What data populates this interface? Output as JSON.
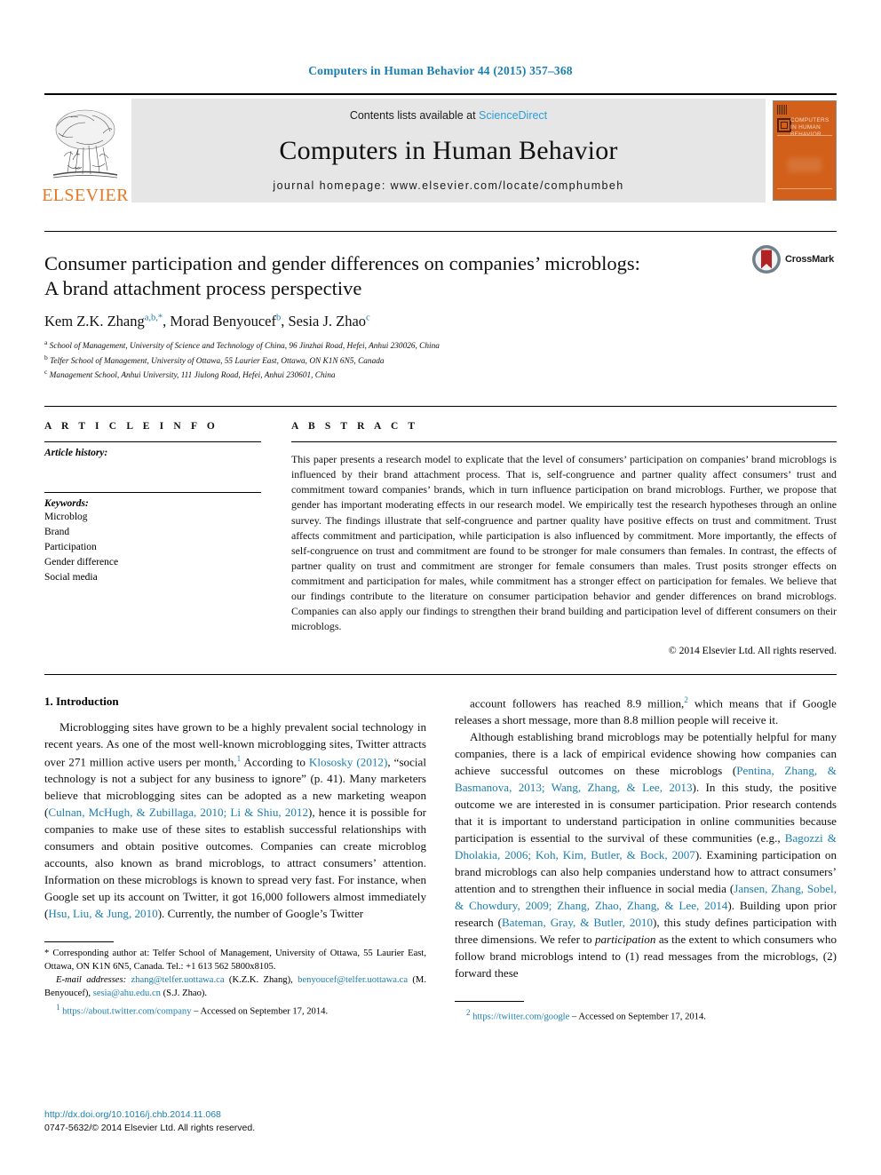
{
  "running_head": "Computers in Human Behavior 44 (2015) 357–368",
  "masthead": {
    "publisher_logo_text": "ELSEVIER",
    "contents_prefix": "Contents lists available at ",
    "contents_link": "ScienceDirect",
    "journal_title": "Computers in Human Behavior",
    "journal_homepage": "journal homepage: www.elsevier.com/locate/comphumbeh",
    "cover_title": "COMPUTERS IN HUMAN BEHAVIOR",
    "accent_orange": "#D2601A",
    "link_blue": "#1a7eb0",
    "sciencedirect_blue": "#2a9fd6"
  },
  "article": {
    "title": "Consumer participation and gender differences on companies’ microblogs: A brand attachment process perspective",
    "authors_html": "Kem Z.K. Zhang<sup>a,b,</sup><sup>*</sup>, Morad Benyoucef<sup>b</sup>, Sesia J. Zhao<sup>c</sup>",
    "affiliations": [
      {
        "marker": "a",
        "text": "School of Management, University of Science and Technology of China, 96 Jinzhai Road, Hefei, Anhui 230026, China"
      },
      {
        "marker": "b",
        "text": "Telfer School of Management, University of Ottawa, 55 Laurier East, Ottawa, ON K1N 6N5, Canada"
      },
      {
        "marker": "c",
        "text": "Management School, Anhui University, 111 Jiulong Road, Hefei, Anhui 230601, China"
      }
    ],
    "crossmark_label": "CrossMark"
  },
  "article_info": {
    "heading": "A R T I C L E   I N F O",
    "history_label": "Article history:",
    "keywords_label": "Keywords:",
    "keywords": [
      "Microblog",
      "Brand",
      "Participation",
      "Gender difference",
      "Social media"
    ]
  },
  "abstract": {
    "heading": "A B S T R A C T",
    "text": "This paper presents a research model to explicate that the level of consumers’ participation on companies’ brand microblogs is influenced by their brand attachment process. That is, self-congruence and partner quality affect consumers’ trust and commitment toward companies’ brands, which in turn influence participation on brand microblogs. Further, we propose that gender has important moderating effects in our research model. We empirically test the research hypotheses through an online survey. The findings illustrate that self-congruence and partner quality have positive effects on trust and commitment. Trust affects commitment and participation, while participation is also influenced by commitment. More importantly, the effects of self-congruence on trust and commitment are found to be stronger for male consumers than females. In contrast, the effects of partner quality on trust and commitment are stronger for female consumers than males. Trust posits stronger effects on commitment and participation for males, while commitment has a stronger effect on participation for females. We believe that our findings contribute to the literature on consumer participation behavior and gender differences on brand microblogs. Companies can also apply our findings to strengthen their brand building and participation level of different consumers on their microblogs.",
    "copyright": "© 2014 Elsevier Ltd. All rights reserved."
  },
  "body": {
    "section_heading": "1. Introduction",
    "left_col": {
      "para1_html": "Microblogging sites have grown to be a highly prevalent social technology in recent years. As one of the most well-known microblogging sites, Twitter attracts over 271 million active users per month,<sup class=\"fn\">1</sup> According to <span class=\"ref\">Klososky (2012)</span>, “social technology is not a subject for any business to ignore” (p. 41). Many marketers believe that microblogging sites can be adopted as a new marketing weapon (<span class=\"ref\">Culnan, McHugh, &amp; Zubillaga, 2010; Li &amp; Shiu, 2012</span>), hence it is possible for companies to make use of these sites to establish successful relationships with consumers and obtain positive outcomes. Companies can create microblog accounts, also known as brand microblogs, to attract consumers’ attention. Information on these microblogs is known to spread very fast. For instance, when Google set up its account on Twitter, it got 16,000 followers almost immediately (<span class=\"ref\">Hsu, Liu, &amp; Jung, 2010</span>). Currently, the number of Google’s Twitter"
    },
    "right_col": {
      "para1_html": "account followers has reached 8.9 million,<sup class=\"fn\">2</sup> which means that if Google releases a short message, more than 8.8 million people will receive it.",
      "para2_html": "Although establishing brand microblogs may be potentially helpful for many companies, there is a lack of empirical evidence showing how companies can achieve successful outcomes on these microblogs (<span class=\"ref\">Pentina, Zhang, &amp; Basmanova, 2013; Wang, Zhang, &amp; Lee, 2013</span>). In this study, the positive outcome we are interested in is consumer participation. Prior research contends that it is important to understand participation in online communities because participation is essential to the survival of these communities (e.g., <span class=\"ref\">Bagozzi &amp; Dholakia, 2006; Koh, Kim, Butler, &amp; Bock, 2007</span>). Examining participation on brand microblogs can also help companies understand how to attract consumers’ attention and to strengthen their influence in social media (<span class=\"ref\">Jansen, Zhang, Sobel, &amp; Chowdury, 2009; Zhang, Zhao, Zhang, &amp; Lee, 2014</span>). Building upon prior research (<span class=\"ref\">Bateman, Gray, &amp; Butler, 2010</span>), this study defines participation with three dimensions. We refer to <span class=\"ital\">participation</span> as the extent to which consumers who follow brand microblogs intend to (1) read messages from the microblogs, (2) forward these"
    }
  },
  "footnotes": {
    "left": {
      "corresponding_html": "<span class=\"fn-indent\"></span>* Corresponding author at: Telfer School of Management, University of Ottawa, 55 Laurier East, Ottawa, ON K1N 6N5, Canada. Tel.: +1 613 562 5800x8105.",
      "email_html": "<span class=\"ital\">E-mail addresses:</span> <span class=\"ref\">zhang@telfer.uottawa.ca</span> (K.Z.K. Zhang), <span class=\"ref\">benyoucef@telfer.uottawa.ca</span> (M. Benyoucef), <span class=\"ref\">sesia@ahu.edu.cn</span> (S.J. Zhao).",
      "note1_html": "<sup class=\"fn\">1</sup> <span class=\"ref\">https://about.twitter.com/company</span> – Accessed on September 17, 2014."
    },
    "right": {
      "note2_html": "<sup class=\"fn\">2</sup> <span class=\"ref\">https://twitter.com/google</span> – Accessed on September 17, 2014."
    }
  },
  "colophon": {
    "doi": "http://dx.doi.org/10.1016/j.chb.2014.11.068",
    "issn_line": "0747-5632/© 2014 Elsevier Ltd. All rights reserved."
  }
}
